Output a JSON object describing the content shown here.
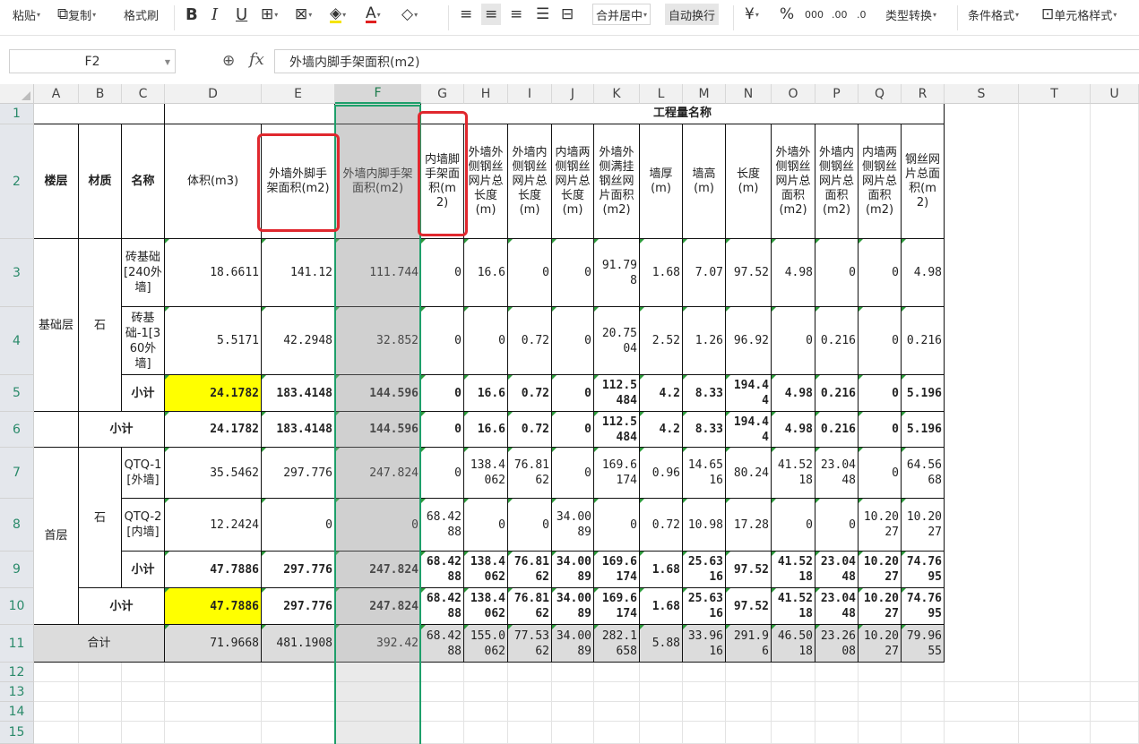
{
  "toolbar": {
    "paste": "粘贴",
    "copy": "复制",
    "format_painter": "格式刷",
    "bold": "B",
    "italic": "I",
    "underline": "U",
    "merge_center": "合并居中",
    "wrap_text": "自动换行",
    "currency": "¥",
    "percent": "%",
    "thousands": "000",
    "dec_inc": ".00",
    "dec_dec": ".0",
    "type_convert": "类型转换",
    "conditional_format": "条件格式",
    "cell_style": "单元格样式"
  },
  "formula_bar": {
    "name_box": "F2",
    "fx": "fx",
    "content": "外墙内脚手架面积(m2)"
  },
  "columns": [
    "A",
    "B",
    "C",
    "D",
    "E",
    "F",
    "G",
    "H",
    "I",
    "J",
    "K",
    "L",
    "M",
    "N",
    "O",
    "P",
    "Q",
    "R",
    "S",
    "T",
    "U"
  ],
  "rows": [
    "1",
    "2",
    "3",
    "4",
    "5",
    "6",
    "7",
    "8",
    "9",
    "10",
    "11",
    "12",
    "13",
    "14",
    "15"
  ],
  "sheet": {
    "title": "工程量名称",
    "headers": {
      "floor": "楼层",
      "material": "材质",
      "name": "名称",
      "volume": "体积(m3)",
      "ext_outer_scaffold": "外墙外脚手架面积(m2)",
      "ext_inner_scaffold": "外墙内脚手架面积(m2)",
      "int_scaffold": "内墙脚手架面积(m2)",
      "ext_outer_mesh_len": "外墙外侧钢丝网片总长度(m)",
      "ext_inner_mesh_len": "外墙内侧钢丝网片总长度(m)",
      "int_both_mesh_len": "内墙两侧钢丝网片总长度(m)",
      "ext_outer_full_mesh": "外墙外侧满挂钢丝网片面积(m2)",
      "wall_thick": "墙厚(m)",
      "wall_height": "墙高(m)",
      "length": "长度(m)",
      "ext_outer_mesh_area": "外墙外侧钢丝网片总面积(m2)",
      "ext_inner_mesh_area": "外墙内侧钢丝网片总面积(m2)",
      "int_both_mesh_area": "内墙两侧钢丝网片总面积(m2)",
      "mesh_total_area": "钢丝网片总面积(m2)"
    },
    "groups": {
      "foundation": "基础层",
      "first": "首层",
      "stone": "石",
      "subtotal": "小计",
      "total": "合计"
    },
    "names": {
      "r3": "砖基础[240外墙]",
      "r4": "砖基础-1[360外墙]",
      "r7": "QTQ-1[外墙]",
      "r8": "QTQ-2[内墙]"
    },
    "data": {
      "r3": [
        "18.6611",
        "141.12",
        "111.744",
        "0",
        "16.6",
        "0",
        "0",
        "91.798",
        "1.68",
        "7.07",
        "97.52",
        "4.98",
        "0",
        "0",
        "4.98"
      ],
      "r4": [
        "5.5171",
        "42.2948",
        "32.852",
        "0",
        "0",
        "0.72",
        "0",
        "20.7504",
        "2.52",
        "1.26",
        "96.92",
        "0",
        "0.216",
        "0",
        "0.216"
      ],
      "r5": [
        "24.1782",
        "183.4148",
        "144.596",
        "0",
        "16.6",
        "0.72",
        "0",
        "112.5484",
        "4.2",
        "8.33",
        "194.44",
        "4.98",
        "0.216",
        "0",
        "5.196"
      ],
      "r6": [
        "24.1782",
        "183.4148",
        "144.596",
        "0",
        "16.6",
        "0.72",
        "0",
        "112.5484",
        "4.2",
        "8.33",
        "194.44",
        "4.98",
        "0.216",
        "0",
        "5.196"
      ],
      "r7": [
        "35.5462",
        "297.776",
        "247.824",
        "0",
        "138.4062",
        "76.8162",
        "0",
        "169.6174",
        "0.96",
        "14.6516",
        "80.24",
        "41.5218",
        "23.0448",
        "0",
        "64.5668"
      ],
      "r8": [
        "12.2424",
        "0",
        "0",
        "68.4288",
        "0",
        "0",
        "34.0089",
        "0",
        "0.72",
        "10.98",
        "17.28",
        "0",
        "0",
        "10.2027",
        "10.2027"
      ],
      "r9": [
        "47.7886",
        "297.776",
        "247.824",
        "68.4288",
        "138.4062",
        "76.8162",
        "34.0089",
        "169.6174",
        "1.68",
        "25.6316",
        "97.52",
        "41.5218",
        "23.0448",
        "10.2027",
        "74.7695"
      ],
      "r10": [
        "47.7886",
        "297.776",
        "247.824",
        "68.4288",
        "138.4062",
        "76.8162",
        "34.0089",
        "169.6174",
        "1.68",
        "25.6316",
        "97.52",
        "41.5218",
        "23.0448",
        "10.2027",
        "74.7695"
      ],
      "r11": [
        "71.9668",
        "481.1908",
        "392.42",
        "68.4288",
        "155.0062",
        "77.5362",
        "34.0089",
        "282.1658",
        "5.88",
        "33.9616",
        "291.96",
        "46.5018",
        "23.2608",
        "10.2027",
        "79.9655"
      ]
    }
  },
  "colors": {
    "accent_green": "#1e9f6a",
    "highlight_yellow": "#ffff00",
    "annotation_red": "#e0282e"
  }
}
